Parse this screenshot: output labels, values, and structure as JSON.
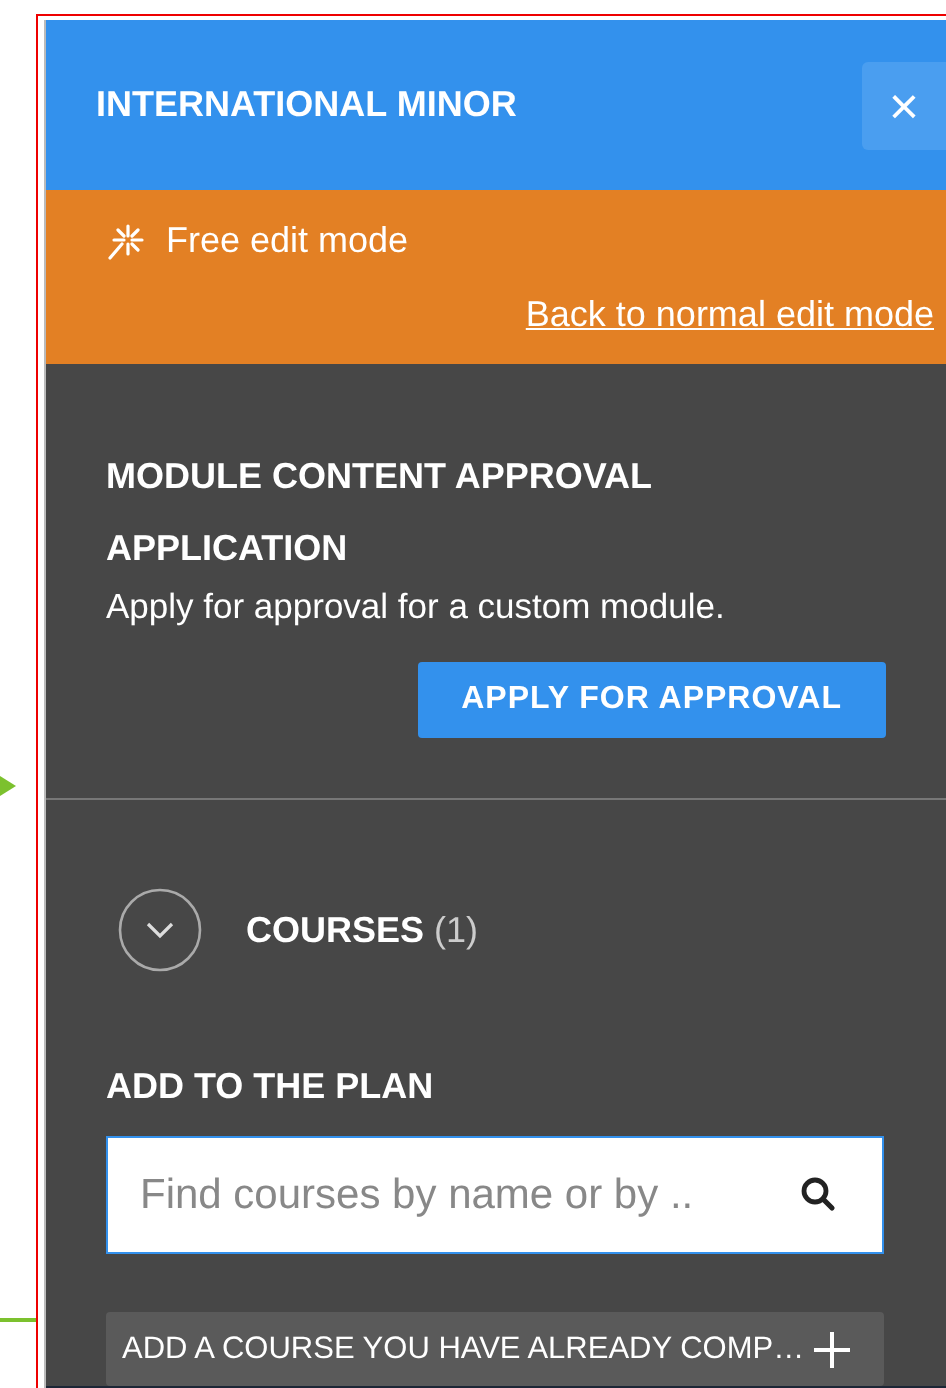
{
  "panel": {
    "title": "INTERNATIONAL MINOR",
    "close_label": "×"
  },
  "mode_banner": {
    "label": "Free edit mode",
    "link": "Back to normal edit mode"
  },
  "approval": {
    "heading": "MODULE CONTENT APPROVAL APPLICATION",
    "description": "Apply for approval for a custom module.",
    "button": "APPLY FOR APPROVAL"
  },
  "courses": {
    "label": "COURSES",
    "count": "(1)",
    "expanded": false
  },
  "add_to_plan": {
    "heading": "ADD TO THE PLAN",
    "search": {
      "placeholder": "Find courses by name or by .."
    },
    "button": "ADD A COURSE YOU HAVE ALREADY COMP…"
  }
}
